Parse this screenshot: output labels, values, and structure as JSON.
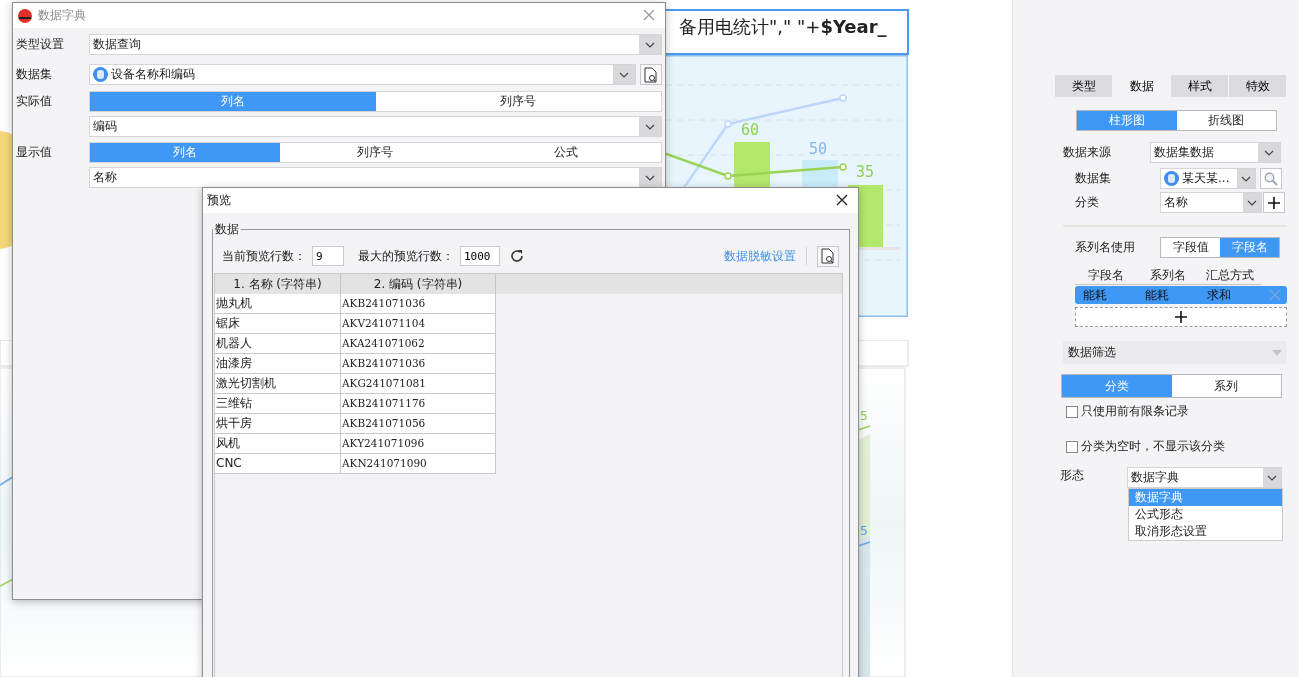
{
  "canvas": {
    "title": "备用电统计\",\"  \"+**$Year_**",
    "upper_labels": [
      {
        "text": "60",
        "color": "#8fd14f"
      },
      {
        "text": "50",
        "color": "#86b6ec"
      },
      {
        "text": "35",
        "color": "#8fd14f"
      }
    ],
    "lower_labels": [
      {
        "text": "5",
        "color": "#8fd14f"
      },
      {
        "text": "5",
        "color": "#5aa4ef"
      }
    ]
  },
  "dictionary_dialog": {
    "title": "数据字典",
    "type_label": "类型设置",
    "type_value": "数据查询",
    "dataset_label": "数据集",
    "dataset_value": "设备名称和编码",
    "actual_label": "实际值",
    "actual_modes": [
      {
        "label": "列名",
        "selected": true
      },
      {
        "label": "列序号",
        "selected": false
      }
    ],
    "actual_value": "编码",
    "display_label": "显示值",
    "display_modes": [
      {
        "label": "列名",
        "selected": true
      },
      {
        "label": "列序号",
        "selected": false
      },
      {
        "label": "公式",
        "selected": false
      }
    ],
    "display_value": "名称"
  },
  "preview_dialog": {
    "title": "预览",
    "group": "数据",
    "current_rows_label": "当前预览行数：",
    "current_rows": "9",
    "max_rows_label": "最大的预览行数：",
    "max_rows": "1000",
    "masking_link": "数据脱敏设置",
    "columns": [
      "1.  名称 (字符串)",
      "2.  编码 (字符串)"
    ],
    "rows": [
      [
        "抛丸机",
        "AKB241071036"
      ],
      [
        "锯床",
        "AKV241071104"
      ],
      [
        "机器人",
        "AKA241071062"
      ],
      [
        "油漆房",
        "AKB241071036"
      ],
      [
        "激光切割机",
        "AKG241071081"
      ],
      [
        "三维钻",
        "AKB241071176"
      ],
      [
        "烘干房",
        "AKB241071056"
      ],
      [
        "风机",
        "AKY241071096"
      ],
      [
        "CNC",
        "AKN241071090"
      ]
    ]
  },
  "side_panel": {
    "tabs": [
      {
        "label": "类型",
        "selected": false
      },
      {
        "label": "数据",
        "selected": true
      },
      {
        "label": "样式",
        "selected": false
      },
      {
        "label": "特效",
        "selected": false
      }
    ],
    "chart_types": [
      {
        "label": "柱形图",
        "selected": true
      },
      {
        "label": "折线图",
        "selected": false
      }
    ],
    "source_label": "数据来源",
    "source_value": "数据集数据",
    "dataset_label": "数据集",
    "dataset_value": "某天某...",
    "category_label": "分类",
    "category_value": "名称",
    "series_name_label": "系列名使用",
    "series_name_modes": [
      {
        "label": "字段值",
        "selected": false
      },
      {
        "label": "字段名",
        "selected": true
      }
    ],
    "series_columns": [
      "字段名",
      "系列名",
      "汇总方式"
    ],
    "series_rows": [
      {
        "cells": [
          "能耗",
          "能耗",
          "求和"
        ],
        "selected": true
      }
    ],
    "filter_title": "数据筛选",
    "filter_modes": [
      {
        "label": "分类",
        "selected": true
      },
      {
        "label": "系列",
        "selected": false
      }
    ],
    "options": [
      {
        "label": "只使用前有限条记录",
        "checked": false
      },
      {
        "label": "分类为空时，不显示该分类",
        "checked": false
      }
    ],
    "form_label": "形态",
    "form_value": "数据字典",
    "form_options": [
      {
        "label": "数据字典",
        "selected": true
      },
      {
        "label": "公式形态",
        "selected": false
      },
      {
        "label": "取消形态设置",
        "selected": false
      }
    ]
  }
}
